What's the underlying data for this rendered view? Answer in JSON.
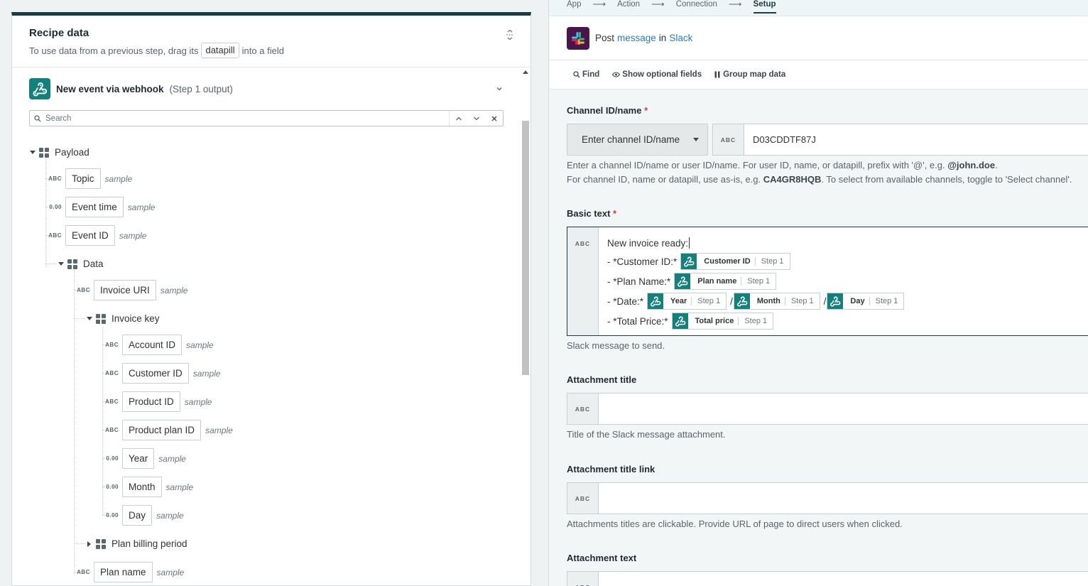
{
  "left": {
    "title": "Recipe data",
    "subtitle_before": "To use data from a previous step, drag its",
    "subtitle_chip": "datapill",
    "subtitle_after": "into a field",
    "step": {
      "name": "New event via webhook",
      "note": "(Step 1 output)"
    },
    "search_placeholder": "Search",
    "sample_label": "sample",
    "tree": {
      "payload": "Payload",
      "topic": {
        "type": "ABC",
        "label": "Topic"
      },
      "event_time": {
        "type": "0.00",
        "label": "Event time"
      },
      "event_id": {
        "type": "ABC",
        "label": "Event ID"
      },
      "data": "Data",
      "invoice_uri": {
        "type": "ABC",
        "label": "Invoice URI"
      },
      "invoice_key": "Invoice key",
      "account_id": {
        "type": "ABC",
        "label": "Account ID"
      },
      "customer_id": {
        "type": "ABC",
        "label": "Customer ID"
      },
      "product_id": {
        "type": "ABC",
        "label": "Product ID"
      },
      "product_plan_id": {
        "type": "ABC",
        "label": "Product plan ID"
      },
      "year": {
        "type": "0.00",
        "label": "Year"
      },
      "month": {
        "type": "0.00",
        "label": "Month"
      },
      "day": {
        "type": "0.00",
        "label": "Day"
      },
      "plan_billing_period": "Plan billing period",
      "plan_name": {
        "type": "ABC",
        "label": "Plan name"
      }
    }
  },
  "right": {
    "crumbs": [
      "App",
      "Action",
      "Connection",
      "Setup"
    ],
    "action": {
      "prefix": "Post",
      "object": "message",
      "middle": "in",
      "app": "Slack"
    },
    "toolbar": {
      "find": "Find",
      "optional": "Show optional fields",
      "group": "Group map data"
    },
    "type_abc": "ABC",
    "channel": {
      "label": "Channel ID/name",
      "required": "*",
      "select_label": "Enter channel ID/name",
      "value": "D03CDDTF87J",
      "hint1_a": "Enter a channel ID/name or user ID/name. For user ID, name, or datapill, prefix with '@', e.g.",
      "hint1_b": "@john.doe",
      "hint1_c": ".",
      "hint2_a": "For channel ID, name or datapill, use as-is, e.g.",
      "hint2_b": "CA4GR8HQB",
      "hint2_c": ". To select from available channels, toggle to 'Select channel'."
    },
    "basic": {
      "label": "Basic text",
      "required": "*",
      "line1": "New invoice ready:",
      "l2": "- *Customer ID:*",
      "l3": "- *Plan Name:*",
      "l4": "- *Date:*",
      "l5": "- *Total Price:*",
      "slash": "/",
      "step_tag": "Step 1",
      "pills": {
        "customer_id": "Customer ID",
        "plan_name": "Plan name",
        "year": "Year",
        "month": "Month",
        "day": "Day",
        "total_price": "Total price"
      },
      "hint": "Slack message to send."
    },
    "att_title": {
      "label": "Attachment title",
      "hint": "Title of the Slack message attachment."
    },
    "att_link": {
      "label": "Attachment title link",
      "hint": "Attachments titles are clickable. Provide URL of page to direct users when clicked."
    },
    "att_text": {
      "label": "Attachment text"
    }
  },
  "colors": {
    "accent_dark": "#1b3a46",
    "webhook_teal": "#13807b",
    "slack_purple": "#4a154b",
    "link_blue": "#2f7ab4",
    "required_red": "#d23b3b"
  }
}
